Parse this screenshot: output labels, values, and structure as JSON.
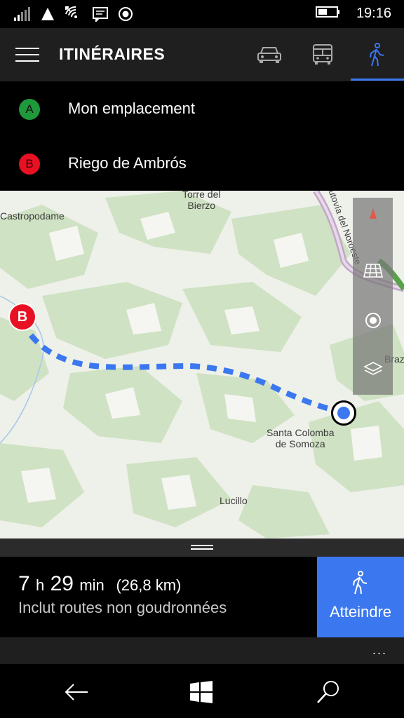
{
  "status_bar": {
    "time": "19:16",
    "icons": [
      "signal-icon",
      "triangle-network-icon",
      "wifi-icon",
      "message-icon",
      "location-icon",
      "battery-icon"
    ]
  },
  "header": {
    "title": "ITINÉRAIRES",
    "modes": [
      "car-icon",
      "bus-icon",
      "walk-icon"
    ],
    "active_mode": "walk",
    "accent_color": "#3b78f0"
  },
  "waypoints": [
    {
      "badge": "A",
      "label": "Mon emplacement",
      "color": "#1e9a3c"
    },
    {
      "badge": "B",
      "label": "Riego de Ambrós",
      "color": "#e81123"
    }
  ],
  "map": {
    "labels": {
      "torre": "Torre del\nBierzo",
      "castropodame": "Castropodame",
      "autovia": "Autovía del Noroeste",
      "santa_colomba": "Santa Colomba\nde Somoza",
      "lucillo": "Lucillo",
      "braz": "Braz"
    },
    "destination_marker": "B",
    "route_color": "#3b78f0",
    "controls": [
      "compass-icon",
      "aerial-view-icon",
      "my-location-icon",
      "layers-icon"
    ]
  },
  "summary": {
    "hours": "7",
    "hours_unit": "h",
    "minutes": "29",
    "minutes_unit": "min",
    "distance": "(26,8 km)",
    "note": "Inclut routes non goudronnées",
    "go_label": "Atteindre"
  },
  "app_bar": {
    "more": "..."
  },
  "nav_bar": [
    "back-icon",
    "windows-home-icon",
    "search-icon"
  ]
}
